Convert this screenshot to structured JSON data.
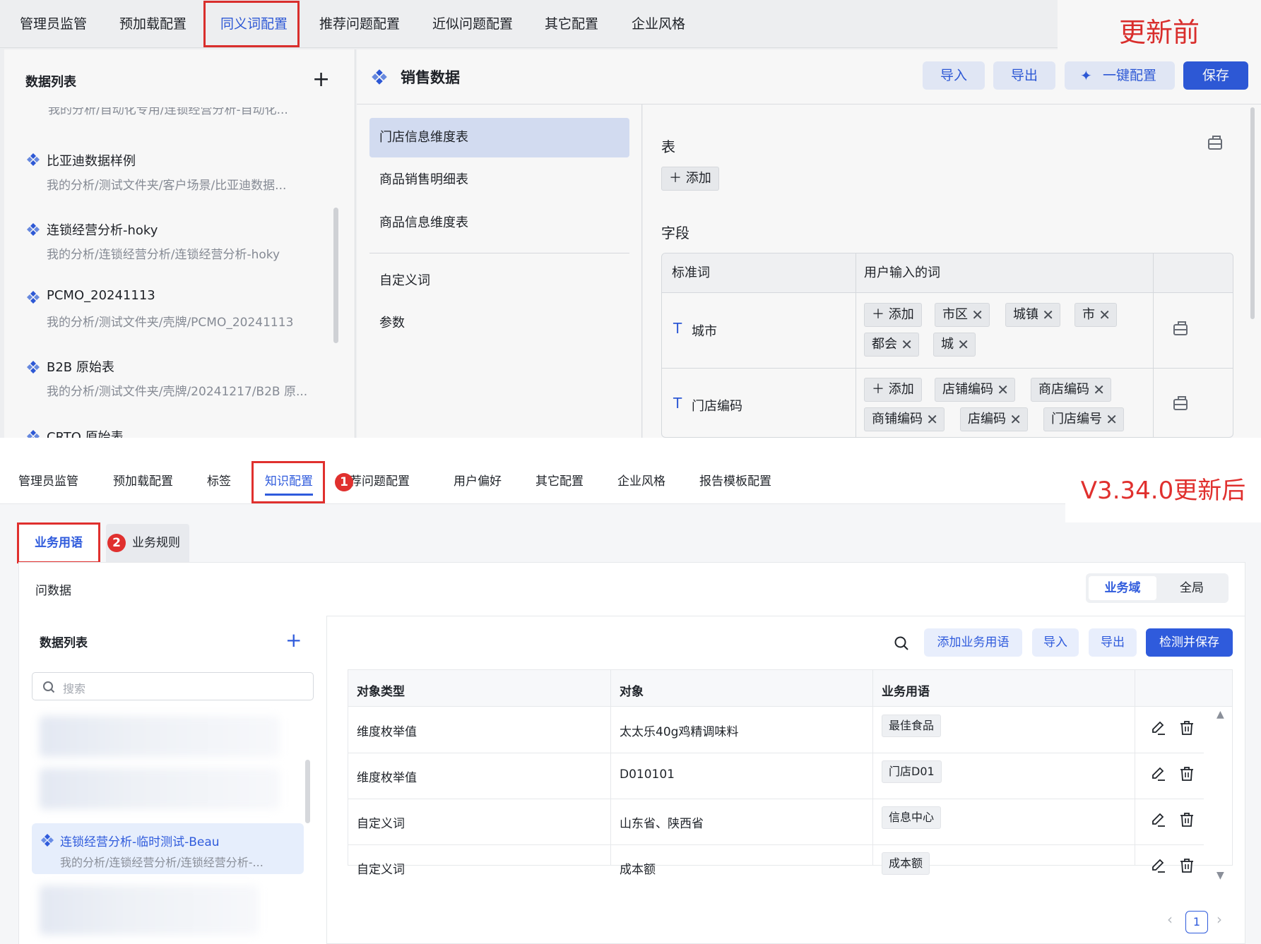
{
  "before": {
    "banner": "更新前",
    "tabs": [
      "管理员监管",
      "预加载配置",
      "同义词配置",
      "推荐问题配置",
      "近似问题配置",
      "其它配置",
      "企业风格"
    ],
    "data_list": {
      "title": "数据列表",
      "cut_path": "我的分析/自动化专用/连锁经营分析-自动化...",
      "items": [
        {
          "name": "比亚迪数据样例",
          "path": "我的分析/测试文件夹/客户场景/比亚迪数据..."
        },
        {
          "name": "连锁经营分析-hoky",
          "path": "我的分析/连锁经营分析/连锁经营分析-hoky"
        },
        {
          "name": "PCMO_20241113",
          "path": "我的分析/测试文件夹/壳牌/PCMO_20241113"
        },
        {
          "name": "B2B 原始表",
          "path": "我的分析/测试文件夹/壳牌/20241217/B2B 原..."
        },
        {
          "name": "CRTO 原始表",
          "path": ""
        }
      ]
    },
    "dataset_title": "销售数据",
    "buttons": {
      "import": "导入",
      "export": "导出",
      "one_click": "一键配置",
      "save": "保存"
    },
    "tables": [
      "门店信息维度表",
      "商品销售明细表",
      "商品信息维度表"
    ],
    "extra_items": [
      "自定义词",
      "参数"
    ],
    "detail": {
      "table_label": "表",
      "add_label": "添加",
      "field_label": "字段",
      "col_std": "标准词",
      "col_user": "用户输入的词",
      "rows": [
        {
          "std": "城市",
          "tags": [
            "市区",
            "城镇",
            "市",
            "都会",
            "城"
          ]
        },
        {
          "std": "门店编码",
          "tags": [
            "店铺编码",
            "商店编码",
            "商铺编码",
            "店编码",
            "门店编号"
          ]
        }
      ]
    }
  },
  "after": {
    "banner": "V3.34.0更新后",
    "tabs": [
      "管理员监管",
      "预加载配置",
      "标签",
      "知识配置",
      "推荐问题配置",
      "用户偏好",
      "其它配置",
      "企业风格",
      "报告模板配置"
    ],
    "badge1": "1",
    "badge2": "2",
    "subtabs": [
      "业务用语",
      "业务规则"
    ],
    "card_title": "问数据",
    "scope": {
      "domain": "业务域",
      "global": "全局"
    },
    "data_list": {
      "title": "数据列表",
      "search_placeholder": "搜索",
      "selected": {
        "name": "连锁经营分析-临时测试-Beau",
        "path": "我的分析/连锁经营分析/连锁经营分析-..."
      }
    },
    "toolbar": {
      "add_term": "添加业务用语",
      "import": "导入",
      "export": "导出",
      "check_save": "检测并保存"
    },
    "table": {
      "headers": [
        "对象类型",
        "对象",
        "业务用语"
      ],
      "rows": [
        {
          "type": "维度枚举值",
          "object": "太太乐40g鸡精调味料",
          "term": "最佳食品"
        },
        {
          "type": "维度枚举值",
          "object": "D010101",
          "term": "门店D01"
        },
        {
          "type": "自定义词",
          "object": "山东省、陕西省",
          "term": "信息中心"
        },
        {
          "type": "自定义词",
          "object": "成本额",
          "term": "成本额"
        }
      ]
    },
    "pager": {
      "current": "1"
    }
  },
  "colors": {
    "accent": "#2f5bdc",
    "highlight_red": "#e0302e",
    "selected_bg": "#e6eefc"
  }
}
